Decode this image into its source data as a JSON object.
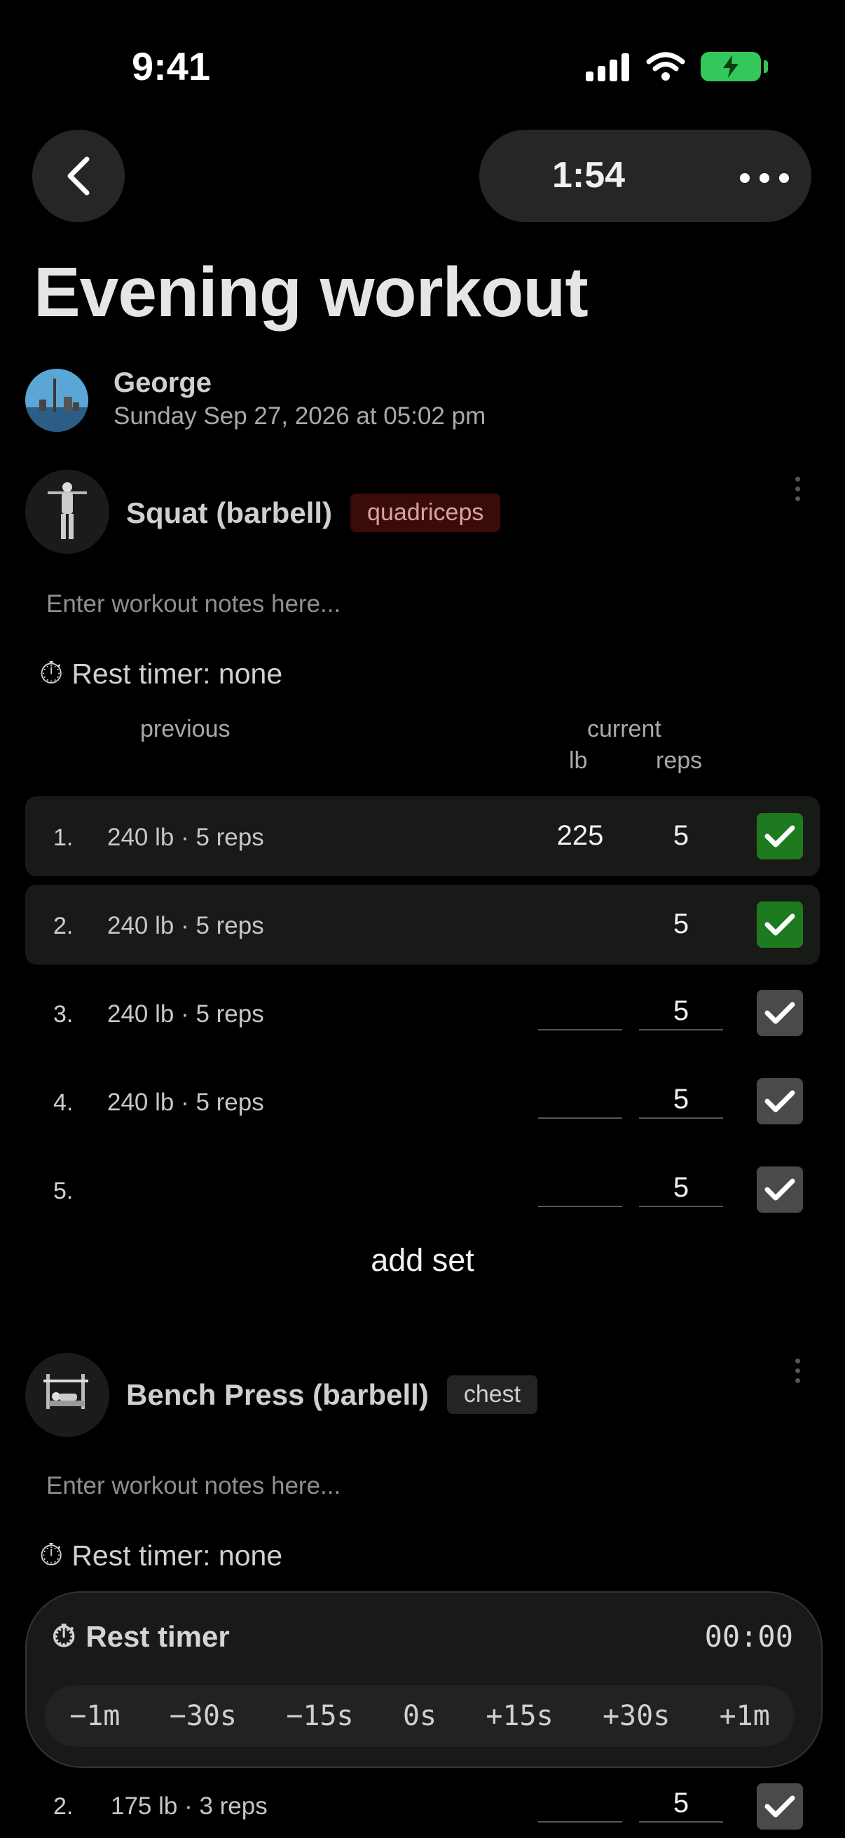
{
  "status": {
    "time": "9:41"
  },
  "header": {
    "timer": "1:54"
  },
  "workout": {
    "title": "Evening workout"
  },
  "user": {
    "name": "George",
    "date": "Sunday Sep 27, 2026 at 05:02 pm"
  },
  "exercises": [
    {
      "name": "Squat (barbell)",
      "tag": "quadriceps",
      "notes_placeholder": "Enter workout notes here...",
      "rest_timer": "Rest timer: none",
      "columns": {
        "previous": "previous",
        "current": "current",
        "lb": "lb",
        "reps": "reps"
      },
      "sets": [
        {
          "num": "1.",
          "previous": "240 lb · 5 reps",
          "lb": "225",
          "reps": "5",
          "done": true
        },
        {
          "num": "2.",
          "previous": "240 lb · 5 reps",
          "lb": "",
          "reps": "5",
          "done": true
        },
        {
          "num": "3.",
          "previous": "240 lb · 5 reps",
          "lb": "",
          "reps": "5",
          "done": false
        },
        {
          "num": "4.",
          "previous": "240 lb · 5 reps",
          "lb": "",
          "reps": "5",
          "done": false
        },
        {
          "num": "5.",
          "previous": "",
          "lb": "",
          "reps": "5",
          "done": false
        }
      ],
      "add_set": "add set"
    },
    {
      "name": "Bench Press (barbell)",
      "tag": "chest",
      "notes_placeholder": "Enter workout notes here...",
      "rest_timer": "Rest timer: none",
      "sets": [
        {
          "num": "2.",
          "previous": "175 lb · 3 reps",
          "lb": "",
          "reps": "5",
          "done": false
        }
      ]
    }
  ],
  "rest_timer_panel": {
    "title": "Rest timer",
    "time": "00:00",
    "steps": [
      "−1m",
      "−30s",
      "−15s",
      "0s",
      "+15s",
      "+30s",
      "+1m"
    ]
  },
  "colors": {
    "done_green": "#1e7a1e",
    "tag_red_bg": "#3a0b0b",
    "battery": "#34c759"
  }
}
